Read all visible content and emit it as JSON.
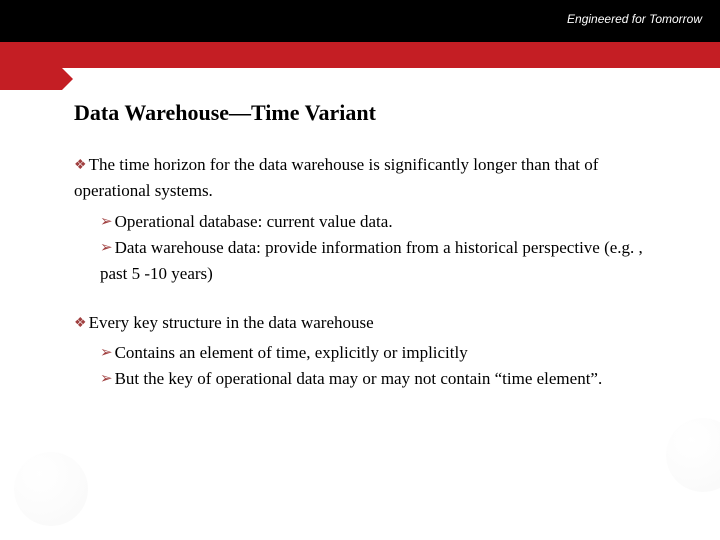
{
  "header": {
    "tagline": "Engineered for Tomorrow"
  },
  "slide": {
    "title": "Data Warehouse—Time Variant",
    "points": [
      {
        "text": "The time horizon for the data warehouse is significantly longer than that of operational systems.",
        "subs": [
          "Operational database: current value data.",
          "Data warehouse data: provide information from a historical perspective (e.g. , past 5 -10 years)"
        ]
      },
      {
        "text": "Every key structure in the data warehouse",
        "subs": [
          "Contains an element of time, explicitly or implicitly",
          "But the key of operational data may or may not contain “time element”."
        ]
      }
    ]
  }
}
